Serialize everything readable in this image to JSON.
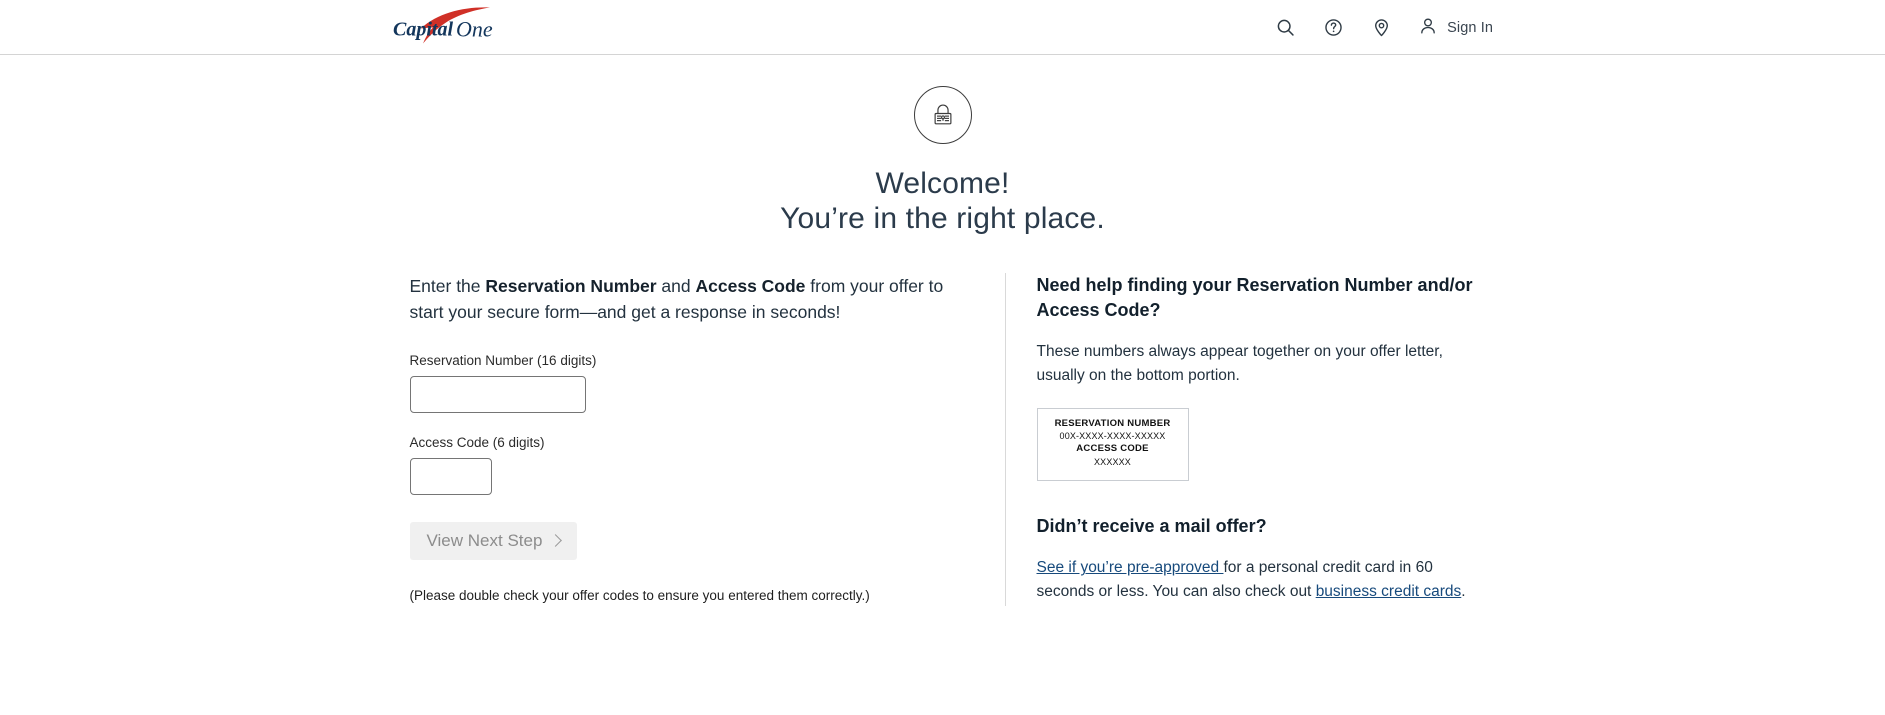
{
  "header": {
    "logo_alt": "Capital One",
    "icons": [
      {
        "name": "search-icon",
        "label": "Search"
      },
      {
        "name": "help-icon",
        "label": "Help"
      },
      {
        "name": "location-icon",
        "label": "Locations"
      }
    ],
    "sign_in_label": "Sign In"
  },
  "hero": {
    "lock_icon": "padlock-icon",
    "title_line1": "Welcome!",
    "title_line2": "You’re in the right place."
  },
  "form": {
    "lead_pre": "Enter the ",
    "lead_b1": "Reservation Number",
    "lead_mid": " and ",
    "lead_b2": "Access Code",
    "lead_post": " from your offer to start your secure form—and get a response in seconds!",
    "reservation_label": "Reservation Number (16 digits)",
    "reservation_value": "",
    "reservation_placeholder": "",
    "access_label": "Access Code (6 digits)",
    "access_value": "",
    "access_placeholder": "",
    "submit_label": "View Next Step",
    "submit_icon": "chevron-right-icon",
    "disclaimer": "(Please double check your offer codes to ensure you entered them correctly.)"
  },
  "help": {
    "heading": "Need help finding your Reservation Number and/or Access Code?",
    "body": "These numbers always appear together on your offer letter, usually on the bottom portion.",
    "letter_example": {
      "reservation_title": "RESERVATION NUMBER",
      "reservation_mask": "00X-XXXX-XXXX-XXXXX",
      "access_title": "ACCESS CODE",
      "access_mask": "XXXXXX"
    },
    "mail_heading": "Didn’t receive a mail offer?",
    "mail_link1": "See if you’re pre-approved ",
    "mail_text_mid": "for a personal credit card in 60 seconds or less. You can also check out ",
    "mail_link2": "business credit cards",
    "mail_text_end": "."
  },
  "colors": {
    "brand_red": "#d03027",
    "brand_navy": "#13365c",
    "link": "#174a7c",
    "heading": "#2b3b4b",
    "border": "#d4d4d4"
  }
}
